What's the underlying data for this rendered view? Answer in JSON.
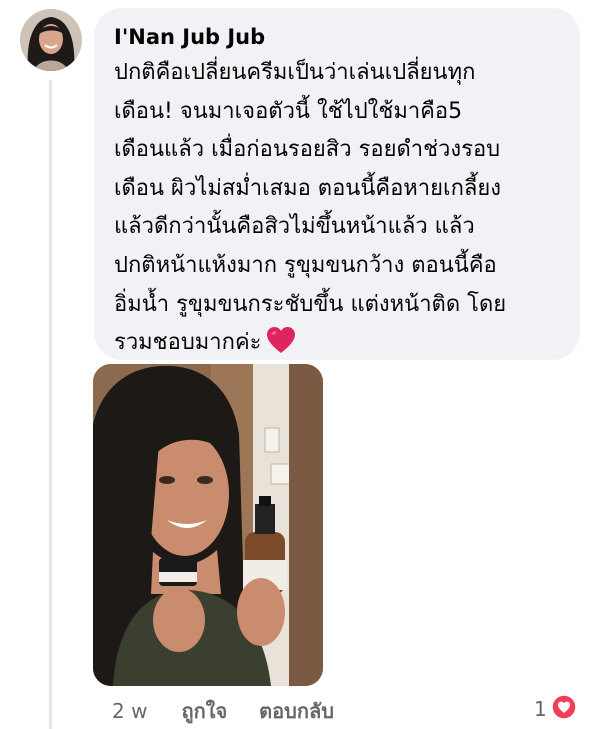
{
  "comment": {
    "author": "I'Nan Jub Jub",
    "text_lines": [
      "ปกติคือเปลี่ยนครีมเป็นว่าเล่นเปลี่ยนทุก",
      "เดือน! จนมาเจอตัวนี้ ใช้ไปใช้มาคือ5",
      "เดือนแล้ว เมื่อก่อนรอยสิว รอยดำช่วงรอบ",
      "เดือน ผิวไม่สม่ำเสมอ ตอนนี้คือหายเกลี้ยง",
      "แล้วดีกว่านั้นคือสิวไม่ขึ้นหน้าแล้ว แล้ว",
      "ปกติหน้าแห้งมาก รูขุมขนกว้าง ตอนนี้คือ",
      "อิ่มน้ำ รูขุมขนกระชับขึ้น แต่งหน้าติด โดย",
      "รวมชอบมากค่ะ"
    ],
    "trailing_emoji": "red-heart-emoji",
    "photo": "photo-woman-holding-skincare-jar-and-serum-bottle"
  },
  "actions": {
    "time": "2 w",
    "like_label": "ถูกใจ",
    "reply_label": "ตอบกลับ"
  },
  "reactions": {
    "count": "1",
    "icon": "love-reaction-icon"
  },
  "colors": {
    "bubble": "#f0f2f5",
    "text": "#050505",
    "secondary": "#65676b",
    "love": "#f33e58",
    "heart_emoji": "#e0245e"
  }
}
